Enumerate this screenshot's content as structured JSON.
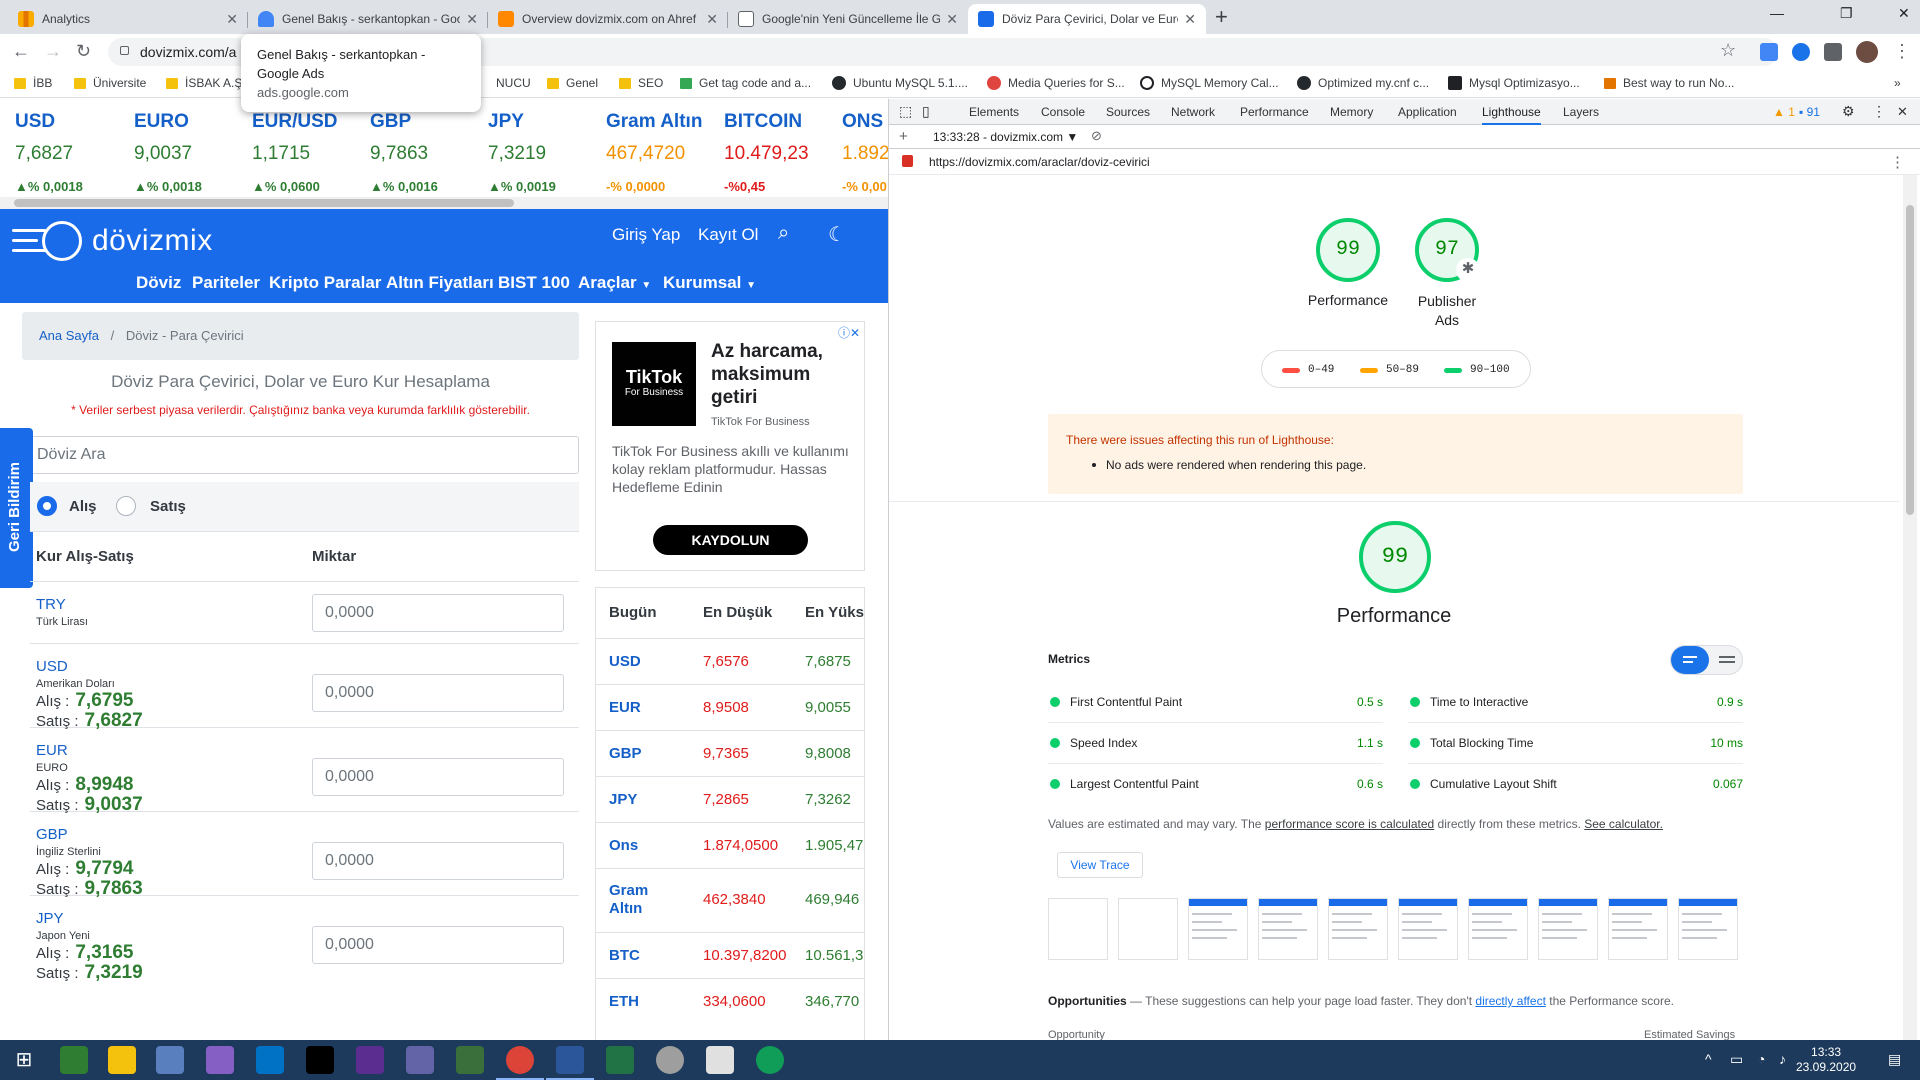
{
  "browser": {
    "tabs": [
      {
        "title": "Analytics",
        "color": "#f9ab00"
      },
      {
        "title": "Genel Bakış - serkantopkan - Goo",
        "color": "#4285f4"
      },
      {
        "title": "Overview dovizmix.com on Ahref",
        "color": "#ff8800"
      },
      {
        "title": "Google'nin Yeni Güncelleme İle G",
        "color": "#5f6368"
      },
      {
        "title": "Döviz Para Çevirici, Dolar ve Euro",
        "color": "#1a6bea"
      }
    ],
    "new_tab": "+",
    "url": "dovizmix.com/a",
    "tooltip": {
      "title": "Genel Bakış - serkantopkan - Google Ads",
      "url": "ads.google.com"
    },
    "bookmarks": [
      "İBB",
      "Üniversite",
      "İSBAK A.Ş",
      "NUCU",
      "Genel",
      "SEO",
      "Get tag code and a...",
      "Ubuntu MySQL 5.1....",
      "Media Queries for S...",
      "MySQL Memory Cal...",
      "Optimized my.cnf c...",
      "Mysql Optimizasyo...",
      "Best way to run No..."
    ]
  },
  "ticker": [
    {
      "name": "USD",
      "value": "7,6827",
      "change": "▲% 0,0018",
      "tone": "green"
    },
    {
      "name": "EURO",
      "value": "9,0037",
      "change": "▲% 0,0018",
      "tone": "green"
    },
    {
      "name": "EUR/USD",
      "value": "1,1715",
      "change": "▲% 0,0600",
      "tone": "green"
    },
    {
      "name": "GBP",
      "value": "9,7863",
      "change": "▲% 0,0016",
      "tone": "green"
    },
    {
      "name": "JPY",
      "value": "7,3219",
      "change": "▲% 0,0019",
      "tone": "green"
    },
    {
      "name": "Gram Altın",
      "value": "467,4720",
      "change": "-% 0,0000",
      "tone": "orange"
    },
    {
      "name": "BITCOIN",
      "value": "10.479,23",
      "change": "-%0,45",
      "tone": "red"
    },
    {
      "name": "ONS",
      "value": "1.892",
      "change": "-% 0,00",
      "tone": "orange"
    }
  ],
  "site": {
    "logo": "dövizmix",
    "login": "Giriş Yap",
    "register": "Kayıt Ol",
    "nav": [
      "Döviz",
      "Pariteler",
      "Kripto Paralar",
      "Altın Fiyatları",
      "BIST 100",
      "Araçlar",
      "Kurumsal"
    ],
    "breadcrumb_home": "Ana Sayfa",
    "breadcrumb_sep": "/",
    "breadcrumb_current": "Döviz - Para Çevirici",
    "title": "Döviz Para Çevirici, Dolar ve Euro Kur Hesaplama",
    "note": "* Veriler serbest piyasa verilerdir. Çalıştığınız banka veya kurumda farklılık gösterebilir.",
    "search_placeholder": "Döviz Ara",
    "feedback": "Geri Bildirim",
    "radio_buy": "Alış",
    "radio_sell": "Satış",
    "col_rate": "Kur Alış-Satış",
    "col_amount": "Miktar",
    "buy_label": "Alış :",
    "sell_label": "Satış :",
    "currencies": [
      {
        "code": "TRY",
        "name": "Türk Lirası",
        "buy": "",
        "sell": "",
        "amount": "0,0000"
      },
      {
        "code": "USD",
        "name": "Amerikan Doları",
        "buy": "7,6795",
        "sell": "7,6827",
        "amount": "0,0000"
      },
      {
        "code": "EUR",
        "name": "EURO",
        "buy": "8,9948",
        "sell": "9,0037",
        "amount": "0,0000"
      },
      {
        "code": "GBP",
        "name": "İngiliz Sterlini",
        "buy": "9,7794",
        "sell": "9,7863",
        "amount": "0,0000"
      },
      {
        "code": "JPY",
        "name": "Japon Yeni",
        "buy": "7,3165",
        "sell": "7,3219",
        "amount": "0,0000"
      }
    ],
    "ad": {
      "logo": "TikTok",
      "logo_sub": "For Business",
      "headline": "Az harcama, maksimum getiri",
      "brand": "TikTok For Business",
      "body": "TikTok For Business akıllı ve kullanımı kolay reklam platformudur. Hassas Hedefleme Edinin",
      "cta": "KAYDOLUN"
    },
    "side_table": {
      "headers": [
        "Bugün",
        "En Düşük",
        "En Yüksek"
      ],
      "rows": [
        {
          "name": "USD",
          "low": "7,6576",
          "high": "7,6875"
        },
        {
          "name": "EUR",
          "low": "8,9508",
          "high": "9,0055"
        },
        {
          "name": "GBP",
          "low": "9,7365",
          "high": "9,8008"
        },
        {
          "name": "JPY",
          "low": "7,2865",
          "high": "7,3262"
        },
        {
          "name": "Ons",
          "low": "1.874,0500",
          "high": "1.905,47"
        },
        {
          "name": "Gram Altın",
          "low": "462,3840",
          "high": "469,946"
        },
        {
          "name": "BTC",
          "low": "10.397,8200",
          "high": "10.561,3"
        },
        {
          "name": "ETH",
          "low": "334,0600",
          "high": "346,770"
        }
      ]
    }
  },
  "devtools": {
    "tabs": [
      "Elements",
      "Console",
      "Sources",
      "Network",
      "Performance",
      "Memory",
      "Application",
      "Lighthouse",
      "Layers"
    ],
    "active_tab": "Lighthouse",
    "warnings": "1",
    "messages": "91",
    "report_time": "13:33:28 - dovizmix.com ▼",
    "report_url": "https://dovizmix.com/araclar/doviz-cevirici",
    "scores": [
      {
        "value": "99",
        "label": "Performance"
      },
      {
        "value": "97",
        "label": "Publisher Ads"
      }
    ],
    "legend": [
      "0–49",
      "50–89",
      "90–100"
    ],
    "warning_title": "There were issues affecting this run of Lighthouse:",
    "warning_item": "No ads were rendered when rendering this page.",
    "main_score": "99",
    "main_label": "Performance",
    "metrics_title": "Metrics",
    "metrics": [
      {
        "label": "First Contentful Paint",
        "value": "0.5 s"
      },
      {
        "label": "Time to Interactive",
        "value": "0.9 s"
      },
      {
        "label": "Speed Index",
        "value": "1.1 s"
      },
      {
        "label": "Total Blocking Time",
        "value": "10 ms"
      },
      {
        "label": "Largest Contentful Paint",
        "value": "0.6 s"
      },
      {
        "label": "Cumulative Layout Shift",
        "value": "0.067"
      }
    ],
    "note_pre": "Values are estimated and may vary. The ",
    "note_link": "performance score is calculated",
    "note_mid": " directly from these metrics. ",
    "note_link2": "See calculator.",
    "view_trace": "View Trace",
    "opp_title": "Opportunities",
    "opp_dash": " — These suggestions can help your page load faster. They don't ",
    "opp_link": "directly affect",
    "opp_end": " the Performance score.",
    "opp_col1": "Opportunity",
    "opp_col2": "Estimated Savings"
  },
  "taskbar": {
    "time": "13:33",
    "date": "23.09.2020"
  }
}
